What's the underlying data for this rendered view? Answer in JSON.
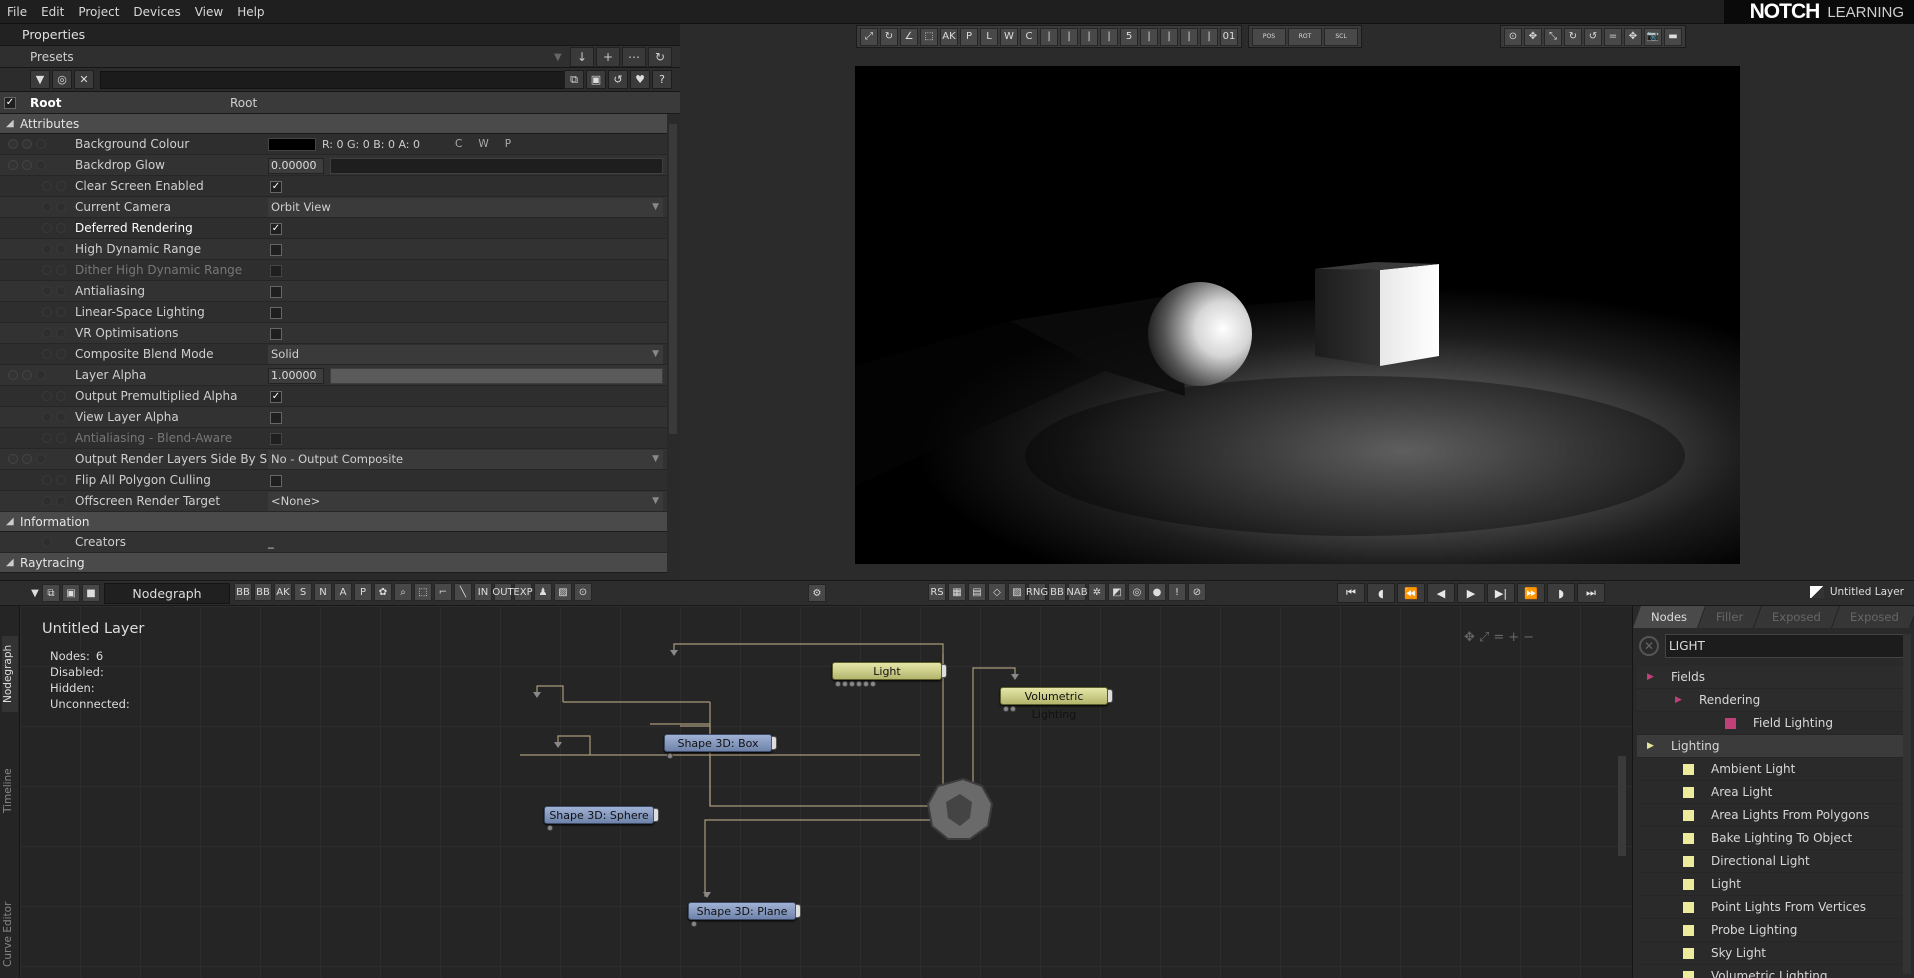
{
  "menu": [
    "File",
    "Edit",
    "Project",
    "Devices",
    "View",
    "Help"
  ],
  "brand": {
    "name": "NOTCH",
    "sub": "LEARNING"
  },
  "properties": {
    "title": "Properties",
    "presets_label": "Presets",
    "root": {
      "label": "Root",
      "value": "Root"
    },
    "sections": {
      "attributes": "Attributes",
      "information": "Information",
      "raytracing": "Raytracing"
    },
    "rows": [
      {
        "label": "Background Colour",
        "type": "color",
        "value": "R: 0 G: 0 B: 0 A: 0",
        "extras": [
          "C",
          "W",
          "P"
        ]
      },
      {
        "label": "Backdrop Glow",
        "type": "number",
        "value": "0.00000",
        "fill": 0
      },
      {
        "label": "Clear Screen Enabled",
        "type": "check",
        "checked": true
      },
      {
        "label": "Current Camera",
        "type": "dropdown",
        "value": "Orbit View"
      },
      {
        "label": "Deferred Rendering",
        "type": "check",
        "checked": true
      },
      {
        "label": "High Dynamic Range",
        "type": "check",
        "checked": false
      },
      {
        "label": "Dither High Dynamic Range",
        "type": "check",
        "checked": false,
        "disabled": true
      },
      {
        "label": "Antialiasing",
        "type": "check",
        "checked": false
      },
      {
        "label": "Linear-Space Lighting",
        "type": "check",
        "checked": false
      },
      {
        "label": "VR Optimisations",
        "type": "check",
        "checked": false
      },
      {
        "label": "Composite Blend Mode",
        "type": "dropdown",
        "value": "Solid"
      },
      {
        "label": "Layer Alpha",
        "type": "number",
        "value": "1.00000",
        "fill": 1
      },
      {
        "label": "Output Premultiplied Alpha",
        "type": "check",
        "checked": true
      },
      {
        "label": "View Layer Alpha",
        "type": "check",
        "checked": false
      },
      {
        "label": "Antialiasing - Blend-Aware",
        "type": "check",
        "checked": false,
        "disabled": true
      },
      {
        "label": "Output Render Layers Side By Side",
        "type": "dropdown",
        "value": "No - Output Composite"
      },
      {
        "label": "Flip All Polygon Culling",
        "type": "check",
        "checked": false
      },
      {
        "label": "Offscreen Render Target",
        "type": "dropdown",
        "value": "<None>"
      }
    ],
    "info_rows": [
      {
        "label": "Creators",
        "value": "_"
      }
    ]
  },
  "viewport_toolbar": {
    "group1": [
      "⤢",
      "↻",
      "∠",
      "⬚",
      "AK",
      "P",
      "L",
      "W",
      "C",
      "|",
      "|",
      "|",
      "|",
      "5",
      "|",
      "|",
      "|",
      "|",
      "01"
    ],
    "locks": [
      "POS",
      "ROT",
      "SCL"
    ],
    "group2": [
      "⊙",
      "✥",
      "⤡",
      "↻",
      "↺",
      "=",
      "✥",
      "📷",
      "▬"
    ]
  },
  "nodegraph": {
    "tab_title": "Nodegraph",
    "left_tabs": [
      "Nodegraph",
      "Timeline",
      "Curve Editor"
    ],
    "tools": [
      "BB",
      "BB",
      "AK",
      "S",
      "N",
      "A",
      "P",
      "✿",
      "⌕",
      "⬚",
      "⌐",
      "╲",
      "IN",
      "OUT",
      "EXP",
      "♟",
      "▨",
      "⊙"
    ],
    "mid_tools": [
      "RS",
      "▦",
      "▤",
      "◇",
      "▨",
      "RNG",
      "BB",
      "NAB",
      "✲",
      "◩",
      "◎",
      "●",
      "!",
      "⊘"
    ],
    "play": [
      "⏮",
      "◖",
      "⏪",
      "◀",
      "▶",
      "▶|",
      "⏩",
      "◗",
      "⏭"
    ],
    "layer_name": "Untitled Layer",
    "header": "Untitled  Layer",
    "stats": [
      {
        "label": "Nodes:",
        "value": "6"
      },
      {
        "label": "Disabled:",
        "value": ""
      },
      {
        "label": "Hidden:",
        "value": ""
      },
      {
        "label": "Unconnected:",
        "value": ""
      }
    ],
    "nodes": {
      "light": "Light",
      "volumetric": "Volumetric  Lighting",
      "box": "Shape 3D:  Box",
      "sphere": "Shape 3D:  Sphere",
      "plane": "Shape 3D:  Plane"
    }
  },
  "nodes_panel": {
    "tabs": [
      "Nodes",
      "Filler",
      "Exposed",
      "Exposed"
    ],
    "search_value": "LIGHT",
    "items": [
      {
        "label": "Fields",
        "level": 0,
        "kind": "category",
        "color": "#c0407a"
      },
      {
        "label": "Rendering",
        "level": 1,
        "kind": "category",
        "color": "#c0407a"
      },
      {
        "label": "Field Lighting",
        "level": 2,
        "kind": "node",
        "color": "#c0407a"
      },
      {
        "label": "Lighting",
        "level": 0,
        "kind": "category",
        "color": "#e6e6a0",
        "selected": true
      },
      {
        "label": "Ambient Light",
        "level": 1,
        "kind": "node",
        "color": "#ecec9c"
      },
      {
        "label": "Area Light",
        "level": 1,
        "kind": "node",
        "color": "#ecec9c"
      },
      {
        "label": "Area Lights From Polygons",
        "level": 1,
        "kind": "node",
        "color": "#ecec9c"
      },
      {
        "label": "Bake Lighting To Object",
        "level": 1,
        "kind": "node",
        "color": "#ecec9c"
      },
      {
        "label": "Directional Light",
        "level": 1,
        "kind": "node",
        "color": "#ecec9c"
      },
      {
        "label": "Light",
        "level": 1,
        "kind": "node",
        "color": "#ecec9c"
      },
      {
        "label": "Point Lights From Vertices",
        "level": 1,
        "kind": "node",
        "color": "#ecec9c"
      },
      {
        "label": "Probe Lighting",
        "level": 1,
        "kind": "node",
        "color": "#ecec9c"
      },
      {
        "label": "Sky Light",
        "level": 1,
        "kind": "node",
        "color": "#ecec9c"
      },
      {
        "label": "Volumetric Lighting",
        "level": 1,
        "kind": "node",
        "color": "#ecec9c"
      }
    ]
  }
}
